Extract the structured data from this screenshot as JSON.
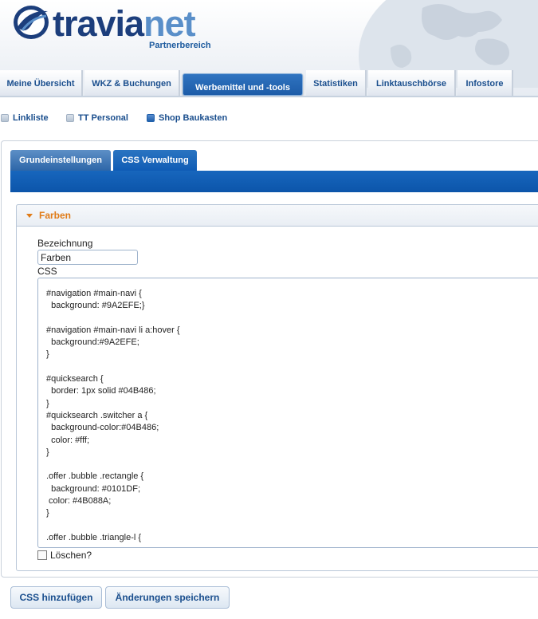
{
  "brand": {
    "name_part1": "travia",
    "name_part2": "net",
    "subtitle": "Partnerbereich"
  },
  "main_nav": [
    {
      "label": "Meine Übersicht",
      "active": false
    },
    {
      "label": "WKZ & Buchungen",
      "active": false
    },
    {
      "label": "Werbemittel und -tools",
      "active": true
    },
    {
      "label": "Statistiken",
      "active": false
    },
    {
      "label": "Linktauschbörse",
      "active": false
    },
    {
      "label": "Infostore",
      "active": false
    }
  ],
  "sub_nav": [
    {
      "label": "Linkliste",
      "active": false
    },
    {
      "label": "TT Personal",
      "active": false
    },
    {
      "label": "Shop Baukasten",
      "active": true
    }
  ],
  "tabs": [
    {
      "label": "Grundeinstellungen",
      "active": false
    },
    {
      "label": "CSS Verwaltung",
      "active": true
    }
  ],
  "section": {
    "title": "Farben",
    "name_label": "Bezeichnung",
    "name_value": "Farben",
    "css_label": "CSS",
    "css_lines": [
      "#navigation #main-navi {",
      "  background: #9A2EFE;}",
      "",
      "#navigation #main-navi li a:hover {",
      "  background:#9A2EFE;",
      "}",
      "",
      "#quicksearch {",
      "  border: 1px solid #04B486;",
      "}",
      "#quicksearch .switcher a {",
      "  background-color:#04B486;",
      "  color: #fff;",
      "}",
      "",
      ".offer .bubble .rectangle {",
      "  background: #0101DF;",
      " color: #4B088A;",
      "}",
      "",
      ".offer .bubble .triangle-l {"
    ],
    "delete_label": "Löschen?",
    "delete_checked": false
  },
  "buttons": {
    "add_css": "CSS hinzufügen",
    "save_changes": "Änderungen speichern"
  },
  "colors": {
    "brand_dark": "#1c3e7c",
    "brand_light": "#5a8fc9",
    "accent_orange": "#e07b17",
    "nav_blue": "#1b4f8e"
  }
}
